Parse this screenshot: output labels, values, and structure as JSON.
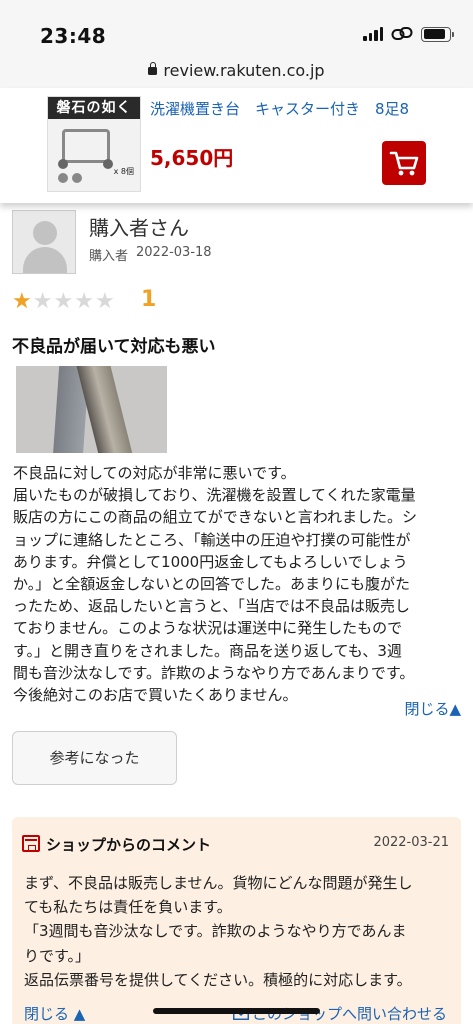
{
  "status_bar": {
    "time": "23:48",
    "battery_level": 0.85
  },
  "url_bar": {
    "url": "review.rakuten.co.jp"
  },
  "product": {
    "thumbnail_title": "磐石の如く",
    "thumbnail_caption": "x 8個",
    "name": "洗濯機置き台　キャスター付き　8足8",
    "price": "5,650円"
  },
  "reviewer": {
    "name": "購入者さん",
    "role": "購入者",
    "date": "2022-03-18"
  },
  "rating": {
    "value": "1",
    "max": 5,
    "stars": [
      "★",
      "★",
      "★",
      "★",
      "★"
    ]
  },
  "review": {
    "title": "不良品が届いて対応も悪い",
    "lines": [
      "不良品に対しての対応が非常に悪いです。",
      "届いたものが破損しており、洗濯機を設置してくれた家電量",
      "販店の方にこの商品の組立てができないと言われました。シ",
      "ョップに連絡したところ、「輸送中の圧迫や打撲の可能性が",
      "あります。弁償として1000円返金してもよろしいでしょう",
      "か。」と全額返金しないとの回答でした。あまりにも腹がた",
      "ったため、返品したいと言うと、「当店では不良品は販売し",
      "ておりません。このような状況は運送中に発生したもので",
      "す。」と開き直りをされました。商品を送り返しても、3週",
      "間も音沙汰なしです。詐欺のようなやり方であんまりです。",
      "今後絶対このお店で買いたくありません。"
    ],
    "collapse_label": "閉じる▲",
    "helpful_label": "参考になった"
  },
  "shop_comment": {
    "title": "ショップからのコメント",
    "date": "2022-03-21",
    "lines": [
      "まず、不良品は販売しません。貨物にどんな問題が発生し",
      "ても私たちは責任を負います。",
      "「3週間も音沙汰なしです。詐欺のようなやり方であんま",
      "りです。」",
      "返品伝票番号を提供してください。積極的に対応します。"
    ],
    "collapse_label": "閉じる ▲",
    "contact_label": "このショップへ問い合わせる"
  },
  "colors": {
    "link": "#1b63b5",
    "price": "#bf0000",
    "star": "#f0a224",
    "comment_bg": "#fdf0e2"
  }
}
